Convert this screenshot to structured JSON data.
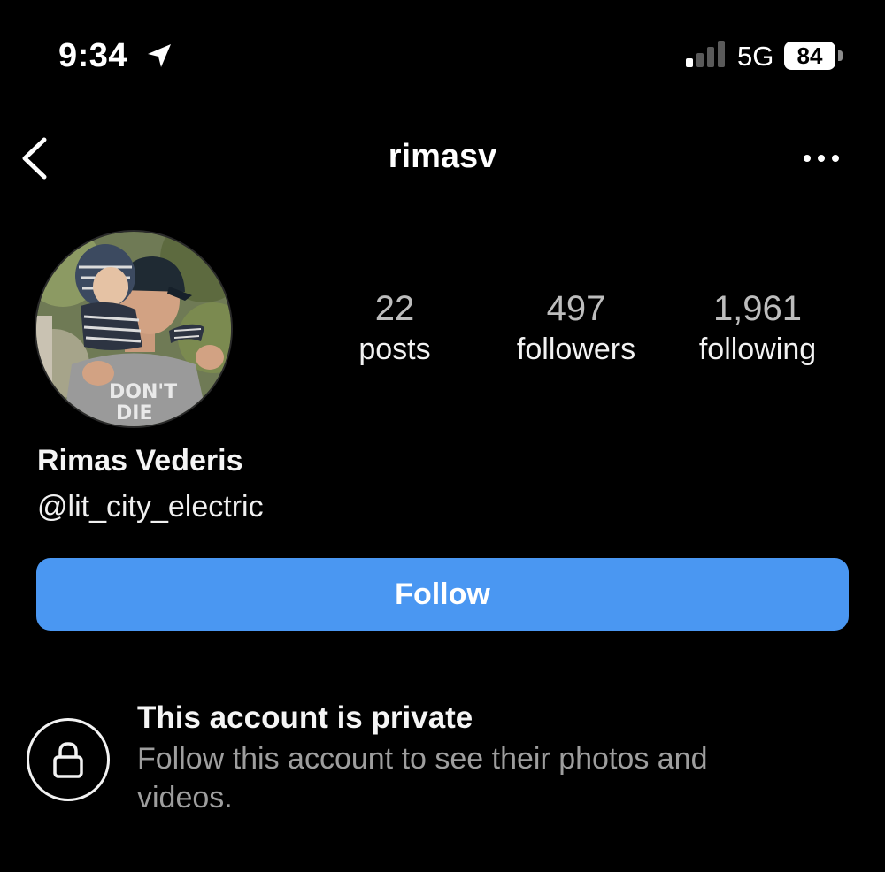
{
  "status_bar": {
    "time": "9:34",
    "network": "5G",
    "battery": "84"
  },
  "header": {
    "username": "rimasv"
  },
  "profile": {
    "stats": [
      {
        "value": "22",
        "label": "posts"
      },
      {
        "value": "497",
        "label": "followers"
      },
      {
        "value": "1,961",
        "label": "following"
      }
    ],
    "display_name": "Rimas Vederis",
    "handle": "@lit_city_electric",
    "avatar_shirt_text": [
      "DON'T",
      "DIE"
    ]
  },
  "actions": {
    "follow_label": "Follow"
  },
  "private_notice": {
    "title": "This account is private",
    "description": "Follow this account to see their photos and videos."
  },
  "colors": {
    "background": "#000000",
    "follow_button": "#4a97f2",
    "muted_text": "#9e9e9e"
  },
  "icons": [
    "location-arrow-icon",
    "cellular-signal-icon",
    "battery-icon",
    "back-chevron-icon",
    "more-options-icon",
    "lock-icon"
  ]
}
